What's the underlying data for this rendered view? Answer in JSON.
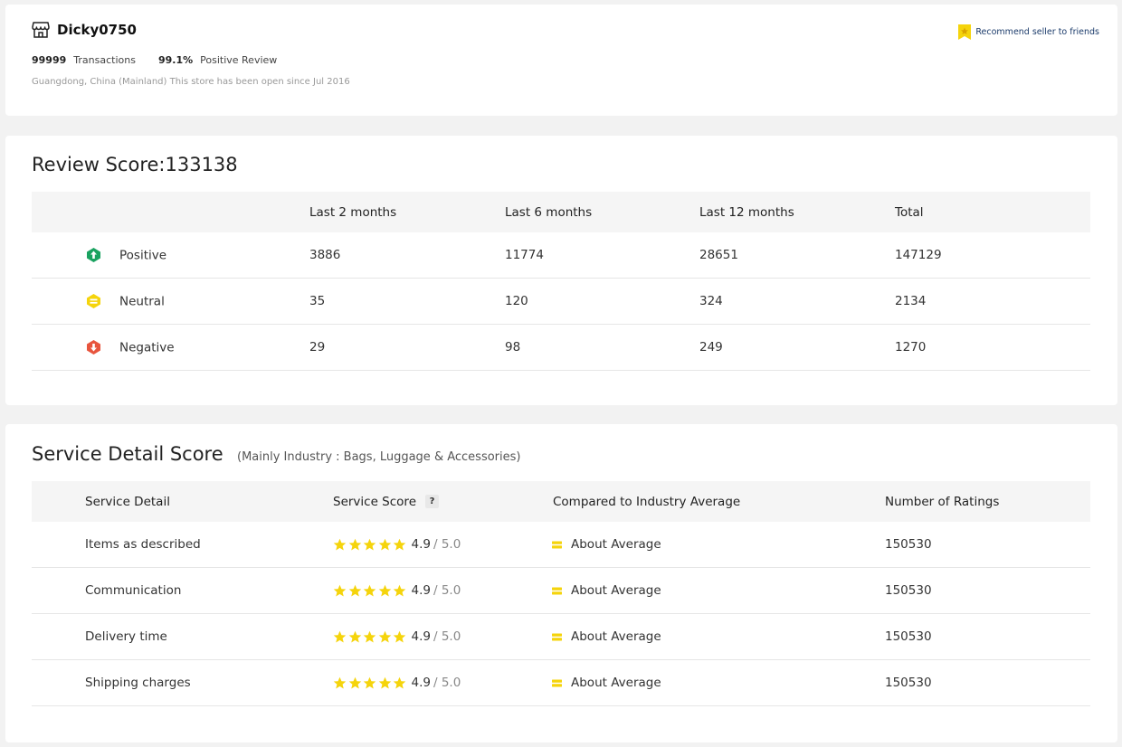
{
  "store": {
    "name": "Dicky0750",
    "transactions_count": "99999",
    "transactions_label": "Transactions",
    "positive_pct": "99.1%",
    "positive_label": "Positive Review",
    "location_text": "Guangdong, China (Mainland) This store has been open since Jul 2016",
    "recommend_label": "Recommend seller to friends"
  },
  "review": {
    "title": "Review Score:133138",
    "headers": [
      "",
      "Last 2 months",
      "Last 6 months",
      "Last 12 months",
      "Total"
    ],
    "rows": [
      {
        "label": "Positive",
        "icon": "up-arrow-icon",
        "color": "#1aa260",
        "values": [
          "3886",
          "11774",
          "28651",
          "147129"
        ]
      },
      {
        "label": "Neutral",
        "icon": "equal-icon",
        "color": "#f5d40c",
        "values": [
          "35",
          "120",
          "324",
          "2134"
        ]
      },
      {
        "label": "Negative",
        "icon": "down-arrow-icon",
        "color": "#e8553e",
        "values": [
          "29",
          "98",
          "249",
          "1270"
        ]
      }
    ]
  },
  "service": {
    "title": "Service Detail Score",
    "subtitle": "(Mainly Industry : Bags, Luggage & Accessories)",
    "headers": [
      "Service Detail",
      "Service Score",
      "Compared to Industry Average",
      "Number of Ratings"
    ],
    "help_label": "?",
    "rows": [
      {
        "label": "Items as described",
        "score": "4.9",
        "max": "/ 5.0",
        "stars": 5,
        "compare": "About Average",
        "ratings": "150530"
      },
      {
        "label": "Communication",
        "score": "4.9",
        "max": "/ 5.0",
        "stars": 5,
        "compare": "About Average",
        "ratings": "150530"
      },
      {
        "label": "Delivery time",
        "score": "4.9",
        "max": "/ 5.0",
        "stars": 5,
        "compare": "About Average",
        "ratings": "150530"
      },
      {
        "label": "Shipping charges",
        "score": "4.9",
        "max": "/ 5.0",
        "stars": 5,
        "compare": "About Average",
        "ratings": "150530"
      }
    ]
  },
  "colors": {
    "star": "#f5d40c",
    "neutral": "#f5d40c",
    "ribbon": "#f5d40c"
  }
}
